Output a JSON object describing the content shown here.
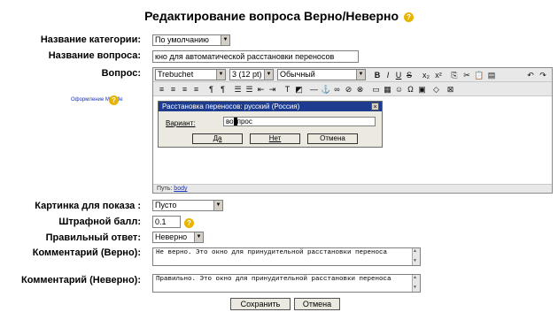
{
  "page": {
    "title": "Редактирование вопроса Верно/Неверно"
  },
  "form": {
    "category_label": "Название категории:",
    "category_value": "По умолчанию",
    "question_name_label": "Название вопроса:",
    "question_name_value": "кно для автоматической расстановки переносов",
    "question_label": "Вопрос:",
    "image_label": "Картинка для показа :",
    "image_value": "Пусто",
    "penalty_label": "Штрафной балл:",
    "penalty_value": "0.1",
    "correct_label": "Правильный ответ:",
    "correct_value": "Неверно",
    "feedback_true_label": "Комментарий (Верно):",
    "feedback_true_value": "Не верно. Это окно для принудительной расстановки переноса",
    "feedback_false_label": "Комментарий (Неверно):",
    "feedback_false_value": "Правильно. Это окно для принудительной расстановки переноса",
    "save_label": "Сохранить",
    "cancel_label": "Отмена",
    "help_link": "Оформление Moodle"
  },
  "editor": {
    "font": "Trebuchet",
    "size": "3 (12 pt)",
    "style": "Обычный",
    "toolbar1_icons": [
      "B",
      "I",
      "U",
      "S",
      "x₂",
      "x²",
      "⎘",
      "✂",
      "📋",
      "▤",
      "↶",
      "↷"
    ],
    "toolbar2_icons": [
      "≡",
      "≡",
      "≡",
      "≡",
      "¶",
      "¶",
      "☰",
      "☰",
      "⇤",
      "⇥",
      "T",
      "◩",
      "—",
      "⚓",
      "∞",
      "⊘",
      "⊗",
      "▭",
      "▦",
      "☺",
      "Ω",
      "▣",
      "◇",
      "⊠"
    ],
    "path_prefix": "Путь:",
    "path_link": "body"
  },
  "dialog": {
    "title": "Расстановка переносов: русский (Россия)",
    "close": "×",
    "variant_label": "Вариант:",
    "variant_value_before": "во",
    "variant_value_after": "прос",
    "yes": "Да",
    "no": "Нет",
    "cancel": "Отмена"
  }
}
